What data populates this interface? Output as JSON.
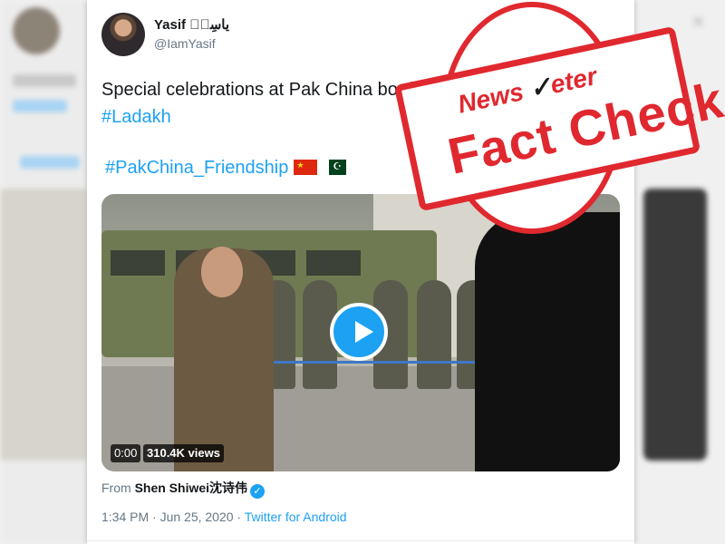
{
  "author": {
    "display_name": "Yasif یاسِفؔ",
    "handle": "@IamYasif"
  },
  "tweet": {
    "text_line1": "Special celebrations at Pak China bord",
    "hashtag1": "#Ladakh",
    "hashtag2": "#PakChina_Friendship"
  },
  "video": {
    "time": "0:00",
    "views": "310.4K views"
  },
  "attribution": {
    "prefix": "From",
    "source_name": "Shen Shiwei沈诗伟"
  },
  "meta": {
    "timestamp": "1:34 PM · Jun 25, 2020 · ",
    "client": "Twitter for Android"
  },
  "stamp": {
    "brand_prefix": "News",
    "brand_suffix": "eter",
    "title": "Fact Check"
  },
  "colors": {
    "link_blue": "#1da1f2",
    "stamp_red": "#e0282f"
  }
}
